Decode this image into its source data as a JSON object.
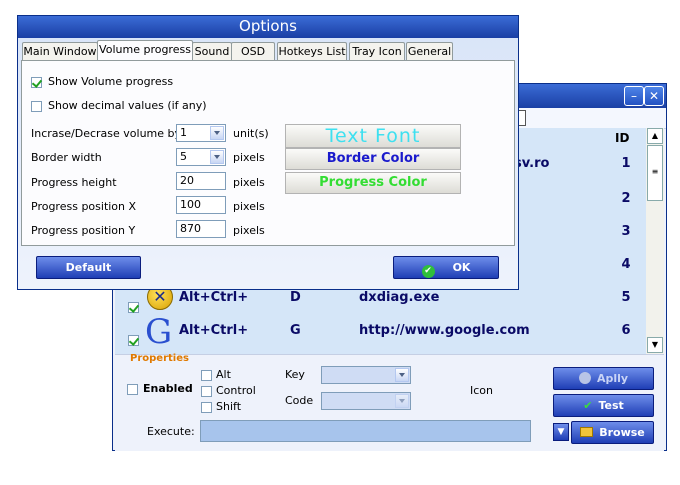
{
  "options_window": {
    "title": "Options",
    "tabs": [
      {
        "label": "Main Window"
      },
      {
        "label": "Volume progress"
      },
      {
        "label": "Sound"
      },
      {
        "label": "OSD"
      },
      {
        "label": "Hotkeys List"
      },
      {
        "label": "Tray Icon"
      },
      {
        "label": "General"
      }
    ],
    "show_volume_progress": {
      "label": "Show Volume progress",
      "checked": true
    },
    "show_decimal": {
      "label": "Show decimal values (if any)",
      "checked": false
    },
    "fields": {
      "increase_by": {
        "label": "Incrase/Decrase volume by",
        "value": "1",
        "unit": "unit(s)"
      },
      "border_width": {
        "label": "Border width",
        "value": "5",
        "unit": "pixels"
      },
      "progress_height": {
        "label": "Progress height",
        "value": "20",
        "unit": "pixels"
      },
      "position_x": {
        "label": "Progress position X",
        "value": "100",
        "unit": "pixels"
      },
      "position_y": {
        "label": "Progress position Y",
        "value": "870",
        "unit": "pixels"
      }
    },
    "buttons": {
      "text_font": "Text Font",
      "border_color": "Border Color",
      "progress_color": "Progress Color",
      "default": "Default",
      "ok": "OK"
    },
    "colors": {
      "text_font": "#3ee0f0",
      "border_color": "#1a1acc",
      "progress_color": "#33dd33"
    }
  },
  "hotkeys_window": {
    "column_id": "ID",
    "rows": [
      {
        "id": "1",
        "hotkey": "",
        "key": "",
        "command": "sv.ro",
        "checked": false
      },
      {
        "id": "2",
        "hotkey": "",
        "key": "",
        "command": "",
        "checked": false
      },
      {
        "id": "3",
        "hotkey": "",
        "key": "",
        "command": "",
        "checked": false
      },
      {
        "id": "4",
        "hotkey": "",
        "key": "",
        "command": "",
        "checked": false
      },
      {
        "id": "5",
        "hotkey": "Alt+Ctrl+",
        "key": "D",
        "command": "dxdiag.exe",
        "checked": true
      },
      {
        "id": "6",
        "hotkey": "Alt+Ctrl+",
        "key": "G",
        "command": "http://www.google.com",
        "checked": true
      }
    ],
    "properties": {
      "title": "Properties",
      "enabled": "Enabled",
      "alt": "Alt",
      "control": "Control",
      "shift": "Shift",
      "key_label": "Key",
      "code_label": "Code",
      "icon_label": "Icon",
      "execute_label": "Execute:",
      "apply": "Aplly",
      "test": "Test",
      "browse": "Browse"
    }
  }
}
